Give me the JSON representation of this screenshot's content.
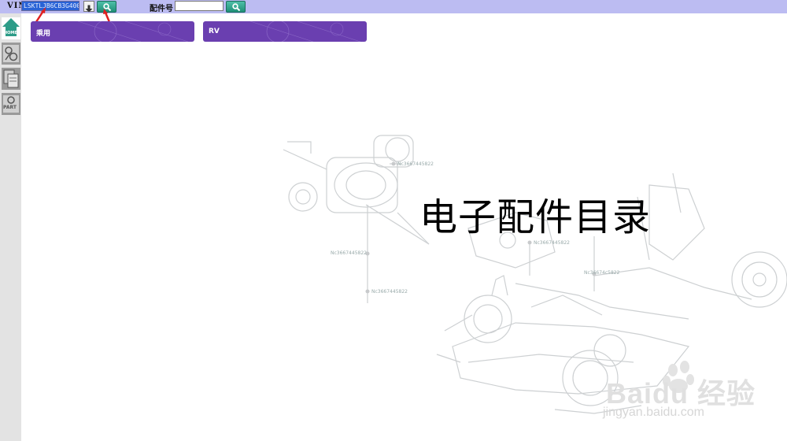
{
  "toolbar": {
    "vin_label": "VIN",
    "vin_value": "LSKTLJB6CB3G400",
    "part_label": "配件号",
    "part_value": ""
  },
  "categories": [
    {
      "label": "乘用"
    },
    {
      "label": "RV"
    }
  ],
  "sidebar": {
    "home_label": "HOME",
    "part_label": "PART"
  },
  "main": {
    "title": "电子配件目录",
    "callouts": [
      "Nc3667445822",
      "Nc3667445822",
      "Nc3667445822",
      "Nc3667445822",
      "Nc36674c5822"
    ]
  },
  "watermark": {
    "brand": "Baidu 经验",
    "url": "jingyan.baidu.com"
  },
  "colors": {
    "toolbar_bg": "#bcbcf2",
    "card_bg": "#6a3fb0",
    "search_button": "#2f9f88",
    "sidebar_bg": "#e3e3e3"
  }
}
